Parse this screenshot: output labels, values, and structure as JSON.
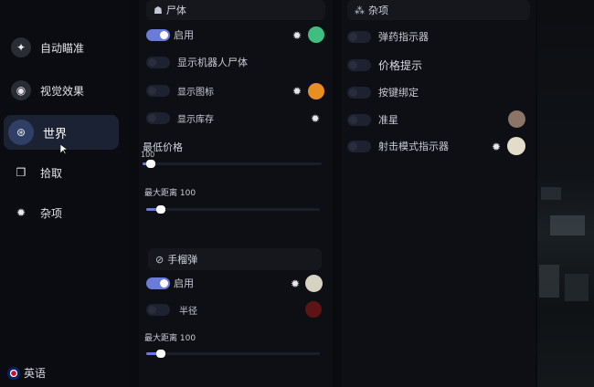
{
  "sidebar": {
    "items": [
      {
        "label": "自动瞄准",
        "icon": "crosshair-icon"
      },
      {
        "label": "视觉效果",
        "icon": "eye-icon"
      },
      {
        "label": "世界",
        "icon": "world-icon",
        "active": true
      },
      {
        "label": "拾取",
        "icon": "box-icon"
      },
      {
        "label": "杂项",
        "icon": "gear-icon"
      }
    ],
    "language": {
      "label": "英语",
      "icon": "uk-flag-icon"
    }
  },
  "body_section": {
    "title": "尸体",
    "rows": [
      {
        "label": "启用",
        "on": true,
        "has_gear": true,
        "color": "#3fbf7f"
      },
      {
        "label": "显示机器人尸体",
        "on": false
      },
      {
        "label": "显示图标",
        "on": false,
        "has_gear": true,
        "color": "#e8901f"
      },
      {
        "label": "显示库存",
        "on": false,
        "has_gear": true
      }
    ],
    "min_price": {
      "label": "最低价格",
      "value": "100",
      "fraction": 0.02
    },
    "max_distance": {
      "label": "最大距离 100",
      "fraction": 0.06
    }
  },
  "grenade_section": {
    "title": "手榴弹",
    "rows": [
      {
        "label": "启用",
        "on": true,
        "has_gear": true,
        "color": "#d6d3c3"
      },
      {
        "label": "半径",
        "on": false,
        "color": "#5c1414"
      }
    ],
    "max_distance": {
      "label": "最大距离 100",
      "fraction": 0.06
    }
  },
  "misc_section": {
    "title": "杂项",
    "rows": [
      {
        "label": "弹药指示器",
        "on": false
      },
      {
        "label": "价格提示",
        "on": false
      },
      {
        "label": "按键绑定",
        "on": false
      },
      {
        "label": "准星",
        "on": false,
        "color": "#8a7566"
      },
      {
        "label": "射击模式指示器",
        "on": false,
        "has_gear": true,
        "color": "#e2dcc8"
      }
    ]
  }
}
